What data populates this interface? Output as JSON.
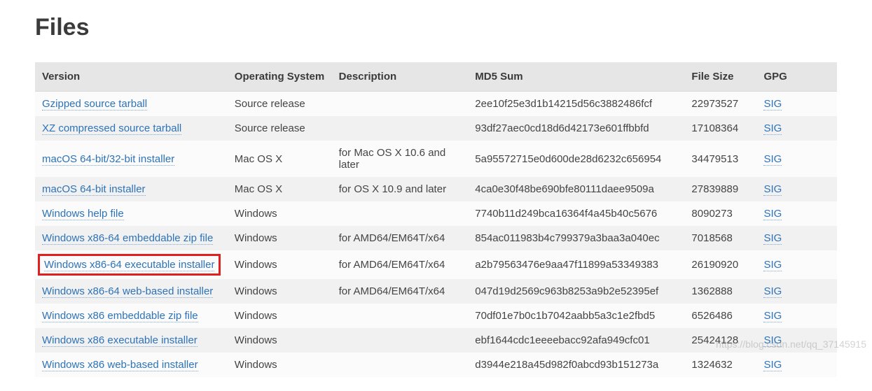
{
  "title": "Files",
  "headers": {
    "version": "Version",
    "os": "Operating System",
    "desc": "Description",
    "md5": "MD5 Sum",
    "size": "File Size",
    "gpg": "GPG"
  },
  "sig_label": "SIG",
  "watermark": "https://blog.csdn.net/qq_37145915",
  "rows": [
    {
      "version": "Gzipped source tarball",
      "os": "Source release",
      "desc": "",
      "md5": "2ee10f25e3d1b14215d56c3882486fcf",
      "size": "22973527",
      "highlight": false
    },
    {
      "version": "XZ compressed source tarball",
      "os": "Source release",
      "desc": "",
      "md5": "93df27aec0cd18d6d42173e601ffbbfd",
      "size": "17108364",
      "highlight": false
    },
    {
      "version": "macOS 64-bit/32-bit installer",
      "os": "Mac OS X",
      "desc": "for Mac OS X 10.6 and later",
      "md5": "5a95572715e0d600de28d6232c656954",
      "size": "34479513",
      "highlight": false
    },
    {
      "version": "macOS 64-bit installer",
      "os": "Mac OS X",
      "desc": "for OS X 10.9 and later",
      "md5": "4ca0e30f48be690bfe80111daee9509a",
      "size": "27839889",
      "highlight": false
    },
    {
      "version": "Windows help file",
      "os": "Windows",
      "desc": "",
      "md5": "7740b11d249bca16364f4a45b40c5676",
      "size": "8090273",
      "highlight": false
    },
    {
      "version": "Windows x86-64 embeddable zip file",
      "os": "Windows",
      "desc": "for AMD64/EM64T/x64",
      "md5": "854ac011983b4c799379a3baa3a040ec",
      "size": "7018568",
      "highlight": false
    },
    {
      "version": "Windows x86-64 executable installer",
      "os": "Windows",
      "desc": "for AMD64/EM64T/x64",
      "md5": "a2b79563476e9aa47f11899a53349383",
      "size": "26190920",
      "highlight": true
    },
    {
      "version": "Windows x86-64 web-based installer",
      "os": "Windows",
      "desc": "for AMD64/EM64T/x64",
      "md5": "047d19d2569c963b8253a9b2e52395ef",
      "size": "1362888",
      "highlight": false
    },
    {
      "version": "Windows x86 embeddable zip file",
      "os": "Windows",
      "desc": "",
      "md5": "70df01e7b0c1b7042aabb5a3c1e2fbd5",
      "size": "6526486",
      "highlight": false
    },
    {
      "version": "Windows x86 executable installer",
      "os": "Windows",
      "desc": "",
      "md5": "ebf1644cdc1eeeebacc92afa949cfc01",
      "size": "25424128",
      "highlight": false
    },
    {
      "version": "Windows x86 web-based installer",
      "os": "Windows",
      "desc": "",
      "md5": "d3944e218a45d982f0abcd93b151273a",
      "size": "1324632",
      "highlight": false
    }
  ]
}
